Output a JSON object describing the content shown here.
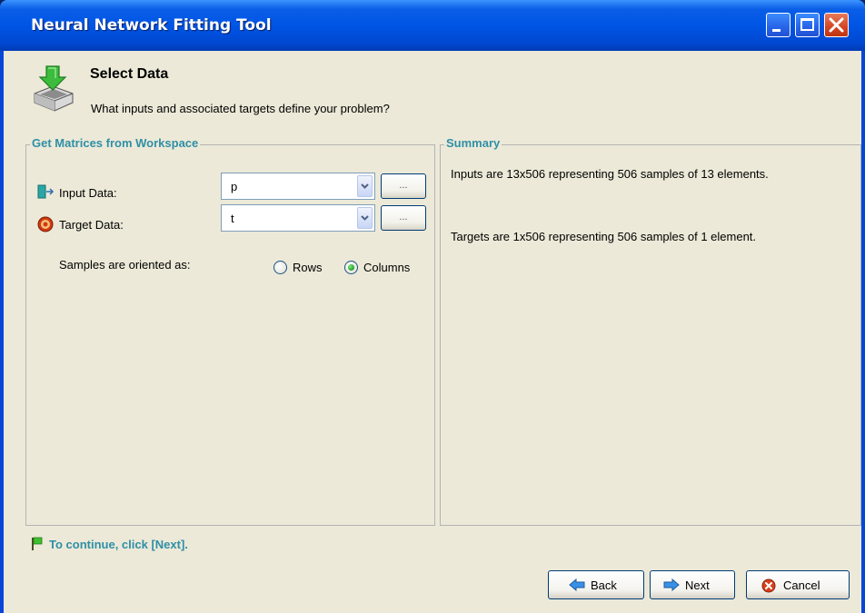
{
  "window": {
    "title": "Neural Network Fitting Tool"
  },
  "header": {
    "title": "Select Data",
    "subtitle": "What inputs and associated targets define your problem?"
  },
  "workspace": {
    "legend": "Get Matrices from Workspace",
    "input_label": "Input Data:",
    "input_value": "p",
    "target_label": "Target Data:",
    "target_value": "t",
    "browse_label": "...",
    "orientation_label": "Samples are oriented as:",
    "rows_label": "Rows",
    "columns_label": "Columns",
    "selected_orientation": "Columns"
  },
  "summary": {
    "legend": "Summary",
    "inputs_text": "Inputs are 13x506 representing 506 samples of 13 elements.",
    "targets_text": "Targets are 1x506 representing 506 samples of 1 element."
  },
  "footer": {
    "hint": "To continue, click [Next].",
    "back_label": "Back",
    "next_label": "Next",
    "cancel_label": "Cancel"
  },
  "colors": {
    "accent": "#2f8fa6",
    "titlebar": "#0055e5",
    "close": "#d44422"
  }
}
